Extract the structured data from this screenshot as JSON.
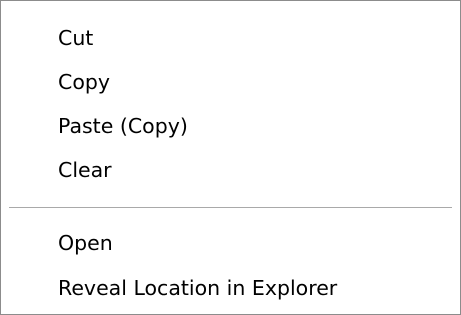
{
  "context_menu": {
    "items": [
      {
        "label": "Cut"
      },
      {
        "label": "Copy"
      },
      {
        "label": "Paste (Copy)"
      },
      {
        "label": "Clear"
      },
      {
        "label": "Open"
      },
      {
        "label": "Reveal Location in Explorer"
      }
    ]
  },
  "colors": {
    "background": "#ffffff",
    "text": "#000000",
    "border": "#8c8c8c",
    "separator": "#a9a9a9",
    "hover": "#316ac5"
  }
}
